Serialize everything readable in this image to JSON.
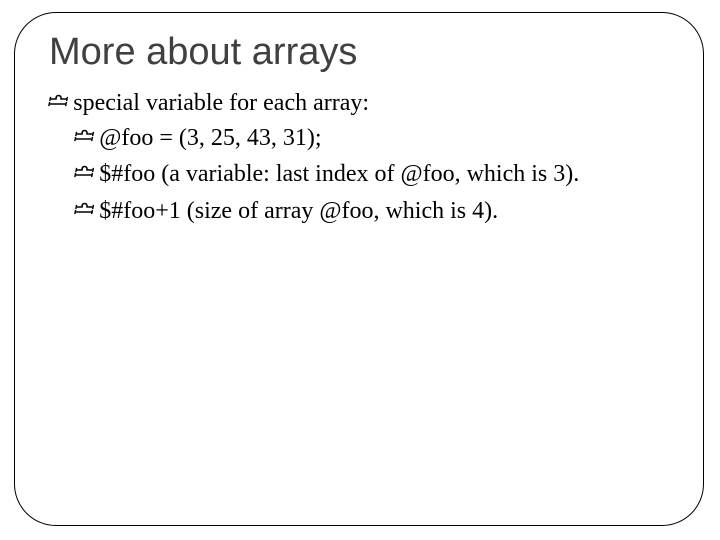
{
  "title": "More about arrays",
  "b1": "special variable for each array:",
  "b2a": "@foo = (3, 25, 43, 31);",
  "b2b": "$#foo (a variable: last index of @foo, which is 3).",
  "b2c": "$#foo+1 (size of array @foo, which is 4)."
}
